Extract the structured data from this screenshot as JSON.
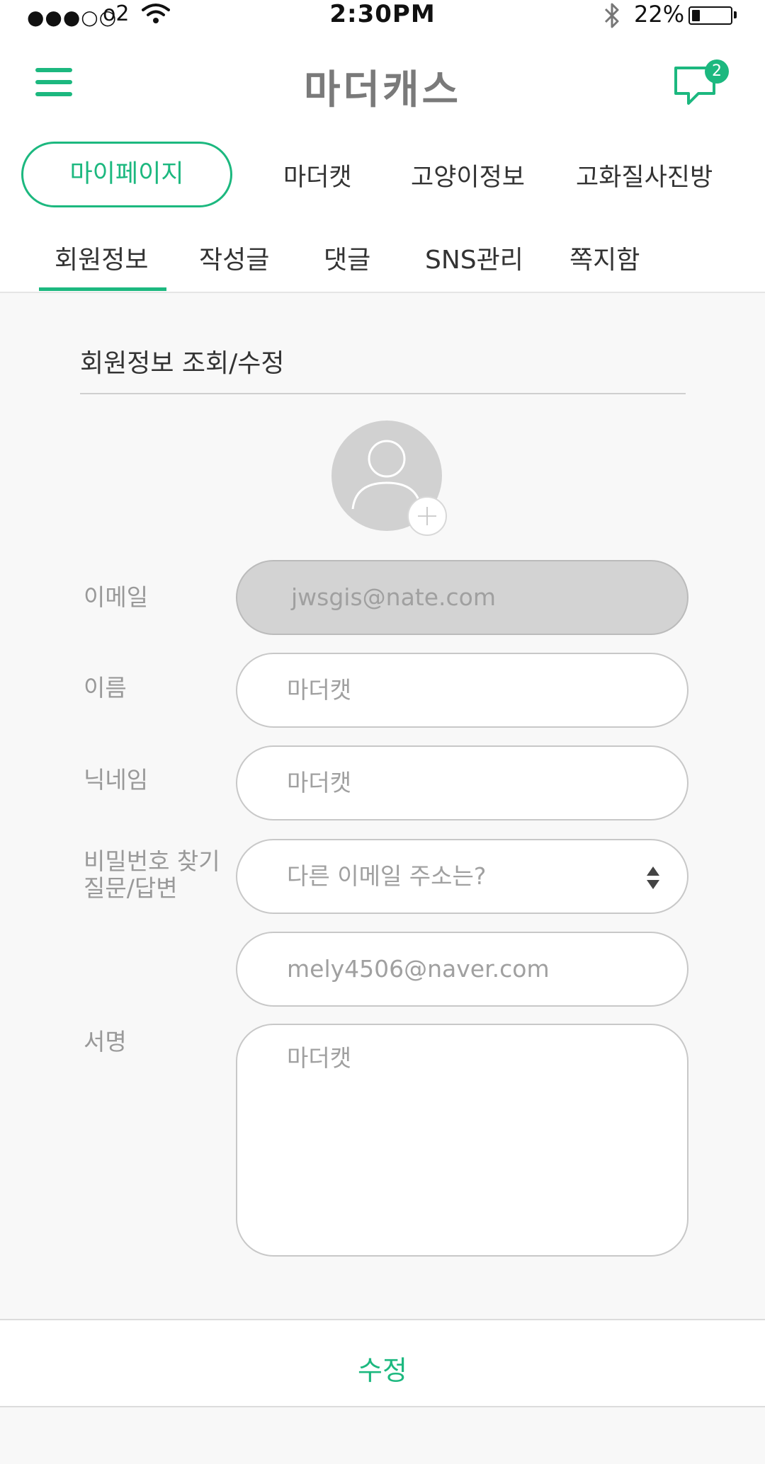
{
  "status_bar": {
    "signal": "●●●○○",
    "carrier": "o2",
    "time": "2:30PM",
    "battery_percent": "22%",
    "battery_level": 0.22
  },
  "header": {
    "logo": "마더캐스",
    "notification_count": "2"
  },
  "main_nav": {
    "items": [
      {
        "label": "마이페이지",
        "active": true
      },
      {
        "label": "마더캣"
      },
      {
        "label": "고양이정보"
      },
      {
        "label": "고화질사진방"
      }
    ]
  },
  "sub_tabs": {
    "items": [
      {
        "label": "회원정보",
        "active": true
      },
      {
        "label": "작성글"
      },
      {
        "label": "댓글"
      },
      {
        "label": "SNS관리"
      },
      {
        "label": "쪽지함"
      }
    ]
  },
  "form": {
    "title": "회원정보 조회/수정",
    "email_label": "이메일",
    "email_value": "jwsgis@nate.com",
    "name_label": "이름",
    "name_value": "마더캣",
    "nickname_label": "닉네임",
    "nickname_value": "마더캣",
    "security_label_line1": "비밀번호 찾기",
    "security_label_line2": "질문/답변",
    "security_question": "다른 이메일 주소는?",
    "security_answer": "mely4506@naver.com",
    "signature_label": "서명",
    "signature_value": "마더캣",
    "submit_label": "수정"
  },
  "colors": {
    "accent": "#1cb87f",
    "background": "#f8f8f8",
    "disabled_field": "#d3d3d3"
  }
}
